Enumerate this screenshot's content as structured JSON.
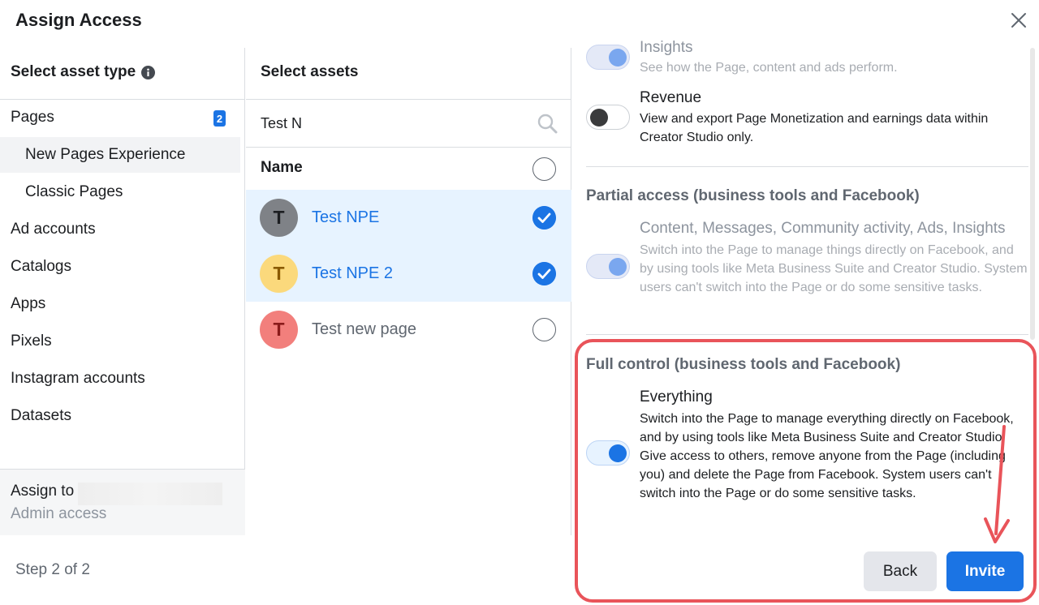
{
  "dialog": {
    "title": "Assign Access"
  },
  "asset_types": {
    "heading": "Select asset type",
    "items": [
      {
        "label": "Pages",
        "badge": "2"
      },
      {
        "label": "New Pages Experience"
      },
      {
        "label": "Classic Pages"
      },
      {
        "label": "Ad accounts"
      },
      {
        "label": "Catalogs"
      },
      {
        "label": "Apps"
      },
      {
        "label": "Pixels"
      },
      {
        "label": "Instagram accounts"
      },
      {
        "label": "Datasets"
      }
    ],
    "assign_to_label": "Assign to",
    "access_level": "Admin access"
  },
  "assets": {
    "heading": "Select assets",
    "search_value": "Test N",
    "name_header": "Name",
    "rows": [
      {
        "initial": "T",
        "name": "Test NPE",
        "selected": true,
        "avatar_color": "#7f8287",
        "initial_color": "#1c1e21"
      },
      {
        "initial": "T",
        "name": "Test NPE 2",
        "selected": true,
        "avatar_color": "#fbd97c",
        "initial_color": "#8a5a00"
      },
      {
        "initial": "T",
        "name": "Test new page",
        "selected": false,
        "avatar_color": "#f27f7c",
        "initial_color": "#8a1a1a"
      }
    ]
  },
  "permissions": {
    "insights": {
      "title": "Insights",
      "desc": "See how the Page, content and ads perform."
    },
    "revenue": {
      "title": "Revenue",
      "desc": "View and export Page Monetization and earnings data within Creator Studio only."
    },
    "partial": {
      "heading": "Partial access (business tools and Facebook)",
      "title": "Content, Messages, Community activity, Ads, Insights",
      "desc": "Switch into the Page to manage things directly on Facebook, and by using tools like Meta Business Suite and Creator Studio. System users can't switch into the Page or do some sensitive tasks."
    },
    "full": {
      "heading": "Full control (business tools and Facebook)",
      "title": "Everything",
      "desc": "Switch into the Page to manage everything directly on Facebook, and by using tools like Meta Business Suite and Creator Studio. Give access to others, remove anyone from the Page (including you) and delete the Page from Facebook. System users can't switch into the Page or do some sensitive tasks."
    }
  },
  "footer": {
    "step": "Step 2 of 2",
    "back_label": "Back",
    "invite_label": "Invite"
  },
  "colors": {
    "accent": "#1b74e4",
    "highlight": "#e9545a"
  }
}
